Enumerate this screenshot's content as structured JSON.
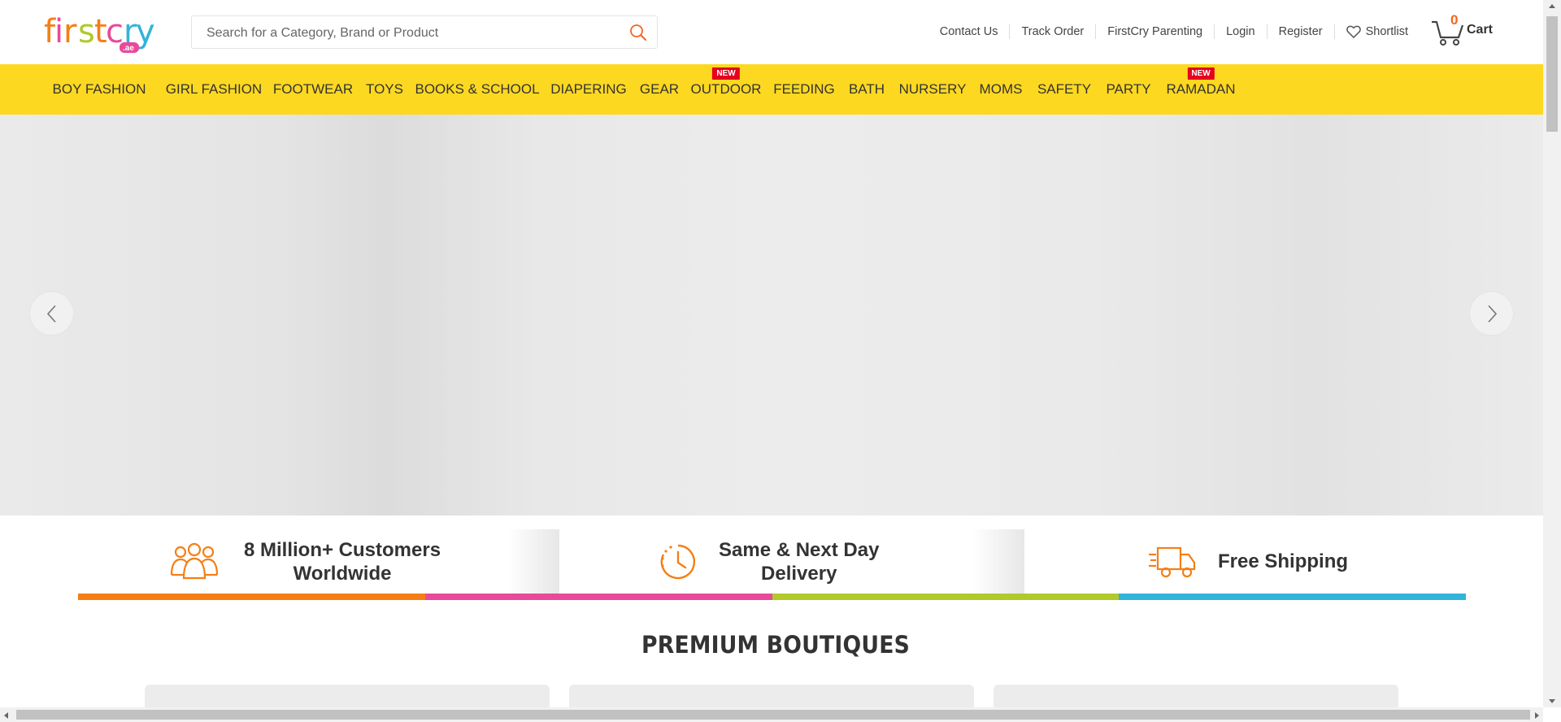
{
  "header": {
    "logo_alt": "firstcry",
    "logo_sub": ".ae",
    "search_placeholder": "Search for a Category, Brand or Product",
    "links": [
      "Contact Us",
      "Track Order",
      "FirstCry Parenting",
      "Login",
      "Register"
    ],
    "shortlist_label": "Shortlist",
    "cart_count": "0",
    "cart_label": "Cart"
  },
  "nav": {
    "items": [
      {
        "label": "BOY FASHION"
      },
      {
        "label": "GIRL FASHION"
      },
      {
        "label": "FOOTWEAR"
      },
      {
        "label": "TOYS"
      },
      {
        "label": "BOOKS & SCHOOL"
      },
      {
        "label": "DIAPERING"
      },
      {
        "label": "GEAR"
      },
      {
        "label": "OUTDOOR",
        "badge": "NEW"
      },
      {
        "label": "FEEDING"
      },
      {
        "label": "BATH"
      },
      {
        "label": "NURSERY"
      },
      {
        "label": "MOMS"
      },
      {
        "label": "SAFETY"
      },
      {
        "label": "PARTY"
      },
      {
        "label": "RAMADAN",
        "badge": "NEW"
      }
    ]
  },
  "features": [
    {
      "line1": "8 Million+ Customers",
      "line2": "Worldwide",
      "icon": "customers-icon"
    },
    {
      "line1": "Same & Next Day",
      "line2": "Delivery",
      "icon": "clock-icon"
    },
    {
      "line1": "Free Shipping",
      "line2": "",
      "icon": "truck-icon"
    }
  ],
  "colors": {
    "accent_orange": "#f26522",
    "nav_yellow": "#fdd820",
    "bar": [
      "#f47f16",
      "#e8499b",
      "#b1c92b",
      "#32b3da"
    ]
  },
  "section": {
    "title": "PREMIUM BOUTIQUES"
  }
}
